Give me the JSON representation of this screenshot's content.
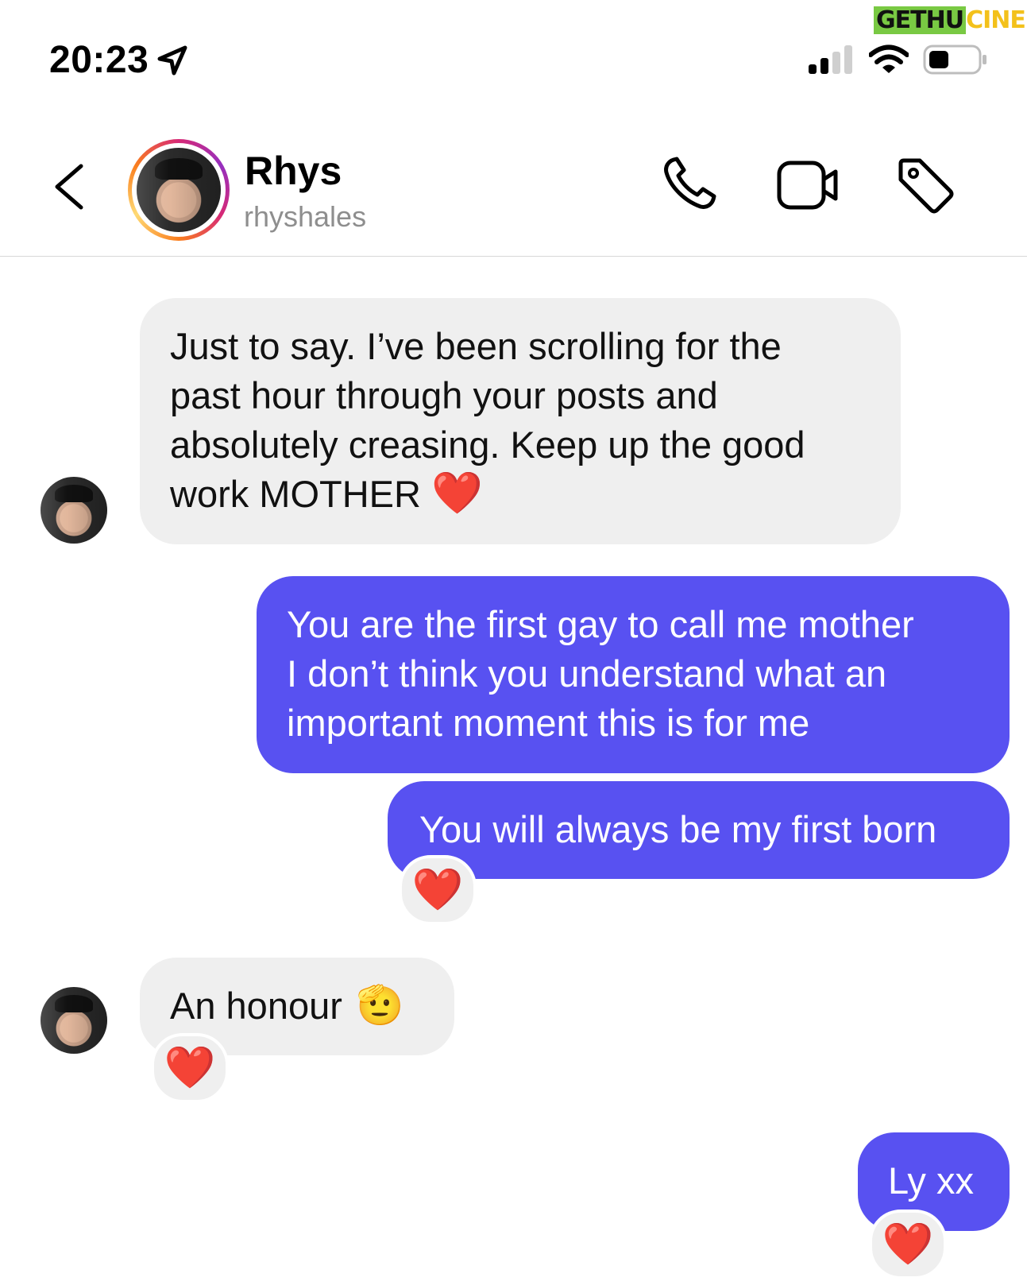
{
  "status_bar": {
    "time": "20:23",
    "watermark": {
      "part1": "GETHU",
      "part2": "CINEMA"
    }
  },
  "header": {
    "name": "Rhys",
    "username": "rhyshales",
    "icons": [
      "back-chevron-icon",
      "phone-icon",
      "video-camera-icon",
      "tag-icon"
    ]
  },
  "messages": [
    {
      "side": "incoming",
      "lines": [
        "Just to say. I’ve been scrolling for the",
        "past hour through your posts and",
        "absolutely creasing. Keep up the good",
        "work MOTHER"
      ],
      "emoji": "❤️"
    },
    {
      "side": "outgoing",
      "lines": [
        "You are the first gay to call me mother",
        "I don’t think you understand what an",
        "important moment this is for me"
      ]
    },
    {
      "side": "outgoing",
      "lines": [
        "You will always be my first born"
      ],
      "reaction": "❤️"
    },
    {
      "side": "incoming",
      "lines": [
        "An honour"
      ],
      "emoji": "🫡",
      "reaction": "❤️"
    },
    {
      "side": "outgoing",
      "lines": [
        "Ly xx"
      ],
      "reaction": "❤️"
    }
  ],
  "colors": {
    "outgoing_bubble": "#5851f1",
    "incoming_bubble": "#efefef",
    "username": "#8e8e8e",
    "heart": "#e8232f"
  }
}
